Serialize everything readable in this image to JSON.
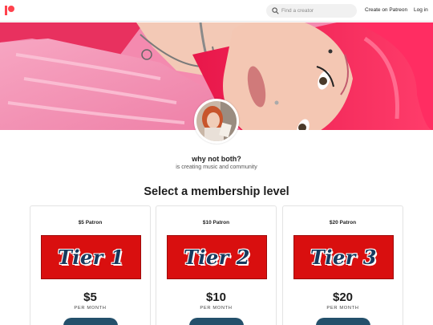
{
  "header": {
    "search_placeholder": "Find a creator",
    "create_link": "Create on Patreon",
    "login_link": "Log in",
    "brand_color": "#ff424d"
  },
  "creator": {
    "name": "why not both?",
    "description": "is creating music and community"
  },
  "membership": {
    "title": "Select a membership level",
    "tiers": [
      {
        "name": "$5 Patron",
        "banner": "Tier 1",
        "price": "$5",
        "period": "PER MONTH",
        "button": ""
      },
      {
        "name": "$10 Patron",
        "banner": "Tier 2",
        "price": "$10",
        "period": "PER MONTH",
        "button": ""
      },
      {
        "name": "$20 Patron",
        "banner": "Tier 3",
        "price": "$20",
        "period": "PER MONTH",
        "button": ""
      }
    ],
    "banner_color": "#d90f0f",
    "button_color": "#24506b"
  }
}
